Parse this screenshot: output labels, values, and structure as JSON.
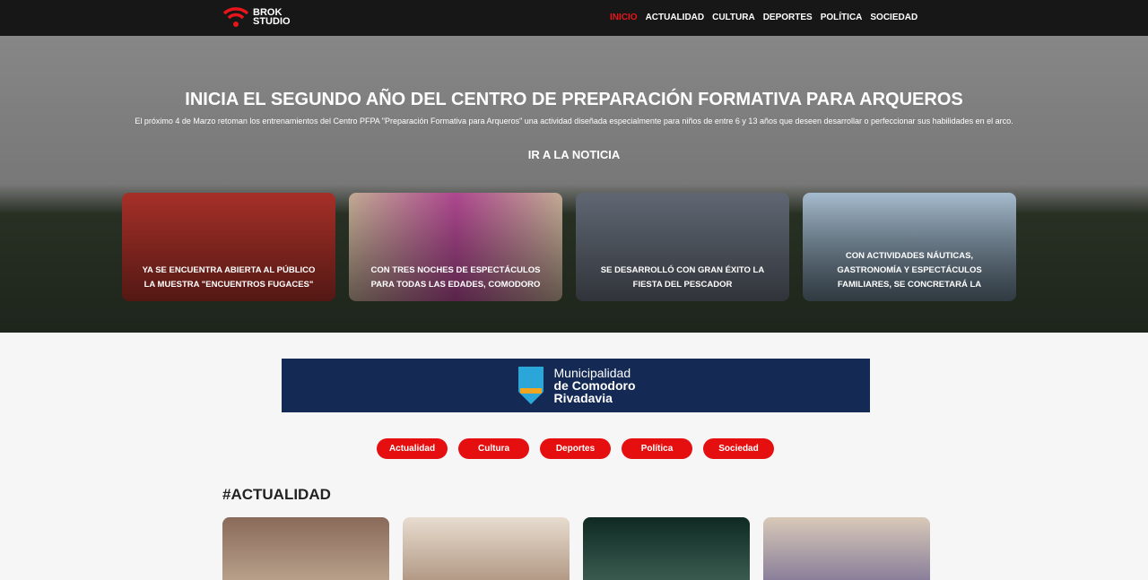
{
  "header": {
    "logo": "BROK STUDIO",
    "menu": [
      "INICIO",
      "ACTUALIDAD",
      "CULTURA",
      "DEPORTES",
      "POLÍTICA",
      "SOCIEDAD"
    ],
    "active": "INICIO"
  },
  "hero": {
    "title": "INICIA EL SEGUNDO AÑO DEL CENTRO DE PREPARACIÓN FORMATIVA PARA ARQUEROS",
    "subtitle": "El próximo 4 de Marzo retoman los entrenamientos del Centro PFPA \"Preparación Formativa para Arqueros\" una actividad diseñada especialmente para niños de entre 6 y 13 años que deseen desarrollar o perfeccionar sus habilidades en el arco.",
    "link": "IR A LA NOTICIA",
    "cards": [
      "YA SE ENCUENTRA ABIERTA AL PÚBLICO LA MUESTRA \"ENCUENTROS FUGACES\"",
      "CON TRES NOCHES DE ESPECTÁCULOS PARA TODAS LAS EDADES, COMODORO",
      "SE DESARROLLÓ CON GRAN ÉXITO LA FIESTA DEL PESCADOR",
      "CON ACTIVIDADES NÁUTICAS, GASTRONOMÍA Y ESPECTÁCULOS FAMILIARES, SE CONCRETARÁ LA"
    ]
  },
  "banner": {
    "line1": "Municipalidad",
    "line2": "de Comodoro",
    "line3": "Rivadavia"
  },
  "categories": [
    "Actualidad",
    "Cultura",
    "Deportes",
    "Política",
    "Sociedad"
  ],
  "section_title": "#ACTUALIDAD",
  "colors": {
    "accent": "#e60f0f",
    "nav": "#171717",
    "banner": "#142a55"
  }
}
